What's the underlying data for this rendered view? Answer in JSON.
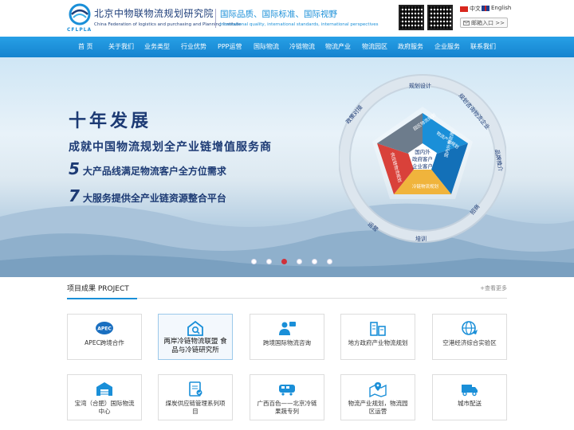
{
  "header": {
    "logo_cn": "北京中物联物流规划研究院",
    "logo_en": "China Federation of logistics and purchasing and Planning Institute",
    "logo_abbr": "CFLPLA",
    "slogan_cn": "国际品质、国际标准、国际视野",
    "slogan_en": "International quality, international standards, international perspectives",
    "lang_cn": "中文",
    "lang_en": "English",
    "mailbox": "邮箱入口 >>"
  },
  "nav": [
    "首 页",
    "关于我们",
    "业务类型",
    "行业优势",
    "PPP运营",
    "国际物流",
    "冷链物流",
    "物流产业",
    "物流园区",
    "政府服务",
    "企业服务",
    "联系我们"
  ],
  "banner": {
    "headline": "十年发展",
    "subline": "成就中国物流规划全产业链增值服务商",
    "feat1_num": "5",
    "feat1_text": "大产品线满足物流客户全方位需求",
    "feat2_num": "7",
    "feat2_text": "大服务提供全产业链资源整合平台",
    "ring_labels": [
      "规划设计",
      "规划咨询物流企业",
      "品牌推介",
      "招商",
      "培训",
      "运营",
      "政策对接"
    ],
    "segments": [
      "园区物流规划",
      "物流产业规划",
      "冷链物流规划",
      "供应链物流规划",
      "国内外物流商"
    ],
    "center_text": [
      "国内外",
      "政府客户",
      "企业客户"
    ],
    "slide_count": 6,
    "active_slide": 3
  },
  "projects": {
    "title": "项目成果 PROJECT",
    "more": "+查看更多",
    "items": [
      {
        "label": "APEC跨境合作",
        "icon": "apec-logo-icon"
      },
      {
        "label": "两岸冷链物流联盟 食品与冷链研究所",
        "icon": "warehouse-search-icon"
      },
      {
        "label": "跨境国际物流咨询",
        "icon": "consultant-icon"
      },
      {
        "label": "地方政府产业物流规划",
        "icon": "buildings-icon"
      },
      {
        "label": "空港经济综合实验区",
        "icon": "globe-plane-icon"
      },
      {
        "label": "宝湾（合肥）国际物流中心",
        "icon": "logistics-center-icon"
      },
      {
        "label": "煤炭供应链管理系列项目",
        "icon": "clipboard-check-icon"
      },
      {
        "label": "广西百色——北京冷链果蔬专列",
        "icon": "train-icon"
      },
      {
        "label": "物流产业规划，物流园区运营",
        "icon": "map-pin-icon"
      },
      {
        "label": "城市配送",
        "icon": "delivery-truck-icon"
      }
    ]
  },
  "colors": {
    "brand_blue": "#1a8fd8",
    "navy": "#1c3a74",
    "active_dot": "#d0303a"
  }
}
